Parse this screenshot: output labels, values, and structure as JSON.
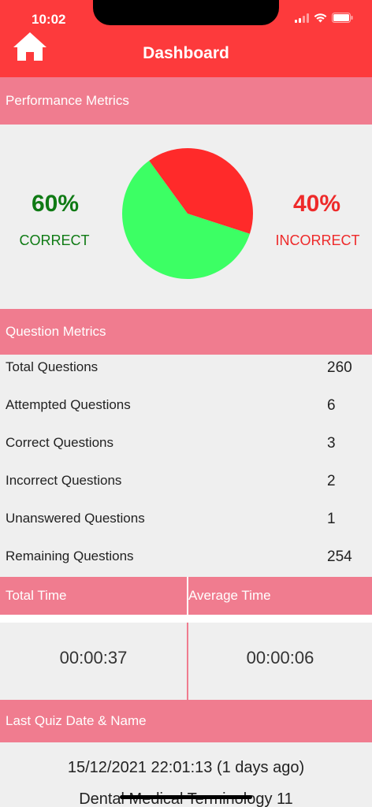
{
  "status_bar": {
    "time": "10:02"
  },
  "header": {
    "title": "Dashboard",
    "home_icon": "home-icon"
  },
  "performance": {
    "section_title": "Performance Metrics",
    "correct_percent": "60%",
    "correct_label": "CORRECT",
    "incorrect_percent": "40%",
    "incorrect_label": "INCORRECT",
    "correct_color": "#3cff64",
    "incorrect_color": "#ff2a2a"
  },
  "chart_data": {
    "type": "pie",
    "categories": [
      "CORRECT",
      "INCORRECT"
    ],
    "values": [
      60,
      40
    ],
    "colors": [
      "#3cff64",
      "#ff2a2a"
    ]
  },
  "questions": {
    "section_title": "Question Metrics",
    "rows": [
      {
        "label": "Total Questions",
        "value": "260"
      },
      {
        "label": "Attempted Questions",
        "value": "6"
      },
      {
        "label": "Correct Questions",
        "value": "3"
      },
      {
        "label": "Incorrect Questions",
        "value": "2"
      },
      {
        "label": "Unanswered Questions",
        "value": "1"
      },
      {
        "label": "Remaining Questions",
        "value": "254"
      }
    ]
  },
  "times": {
    "total_label": "Total Time",
    "total_value": "00:00:37",
    "average_label": "Average Time",
    "average_value": "00:00:06"
  },
  "last_quiz": {
    "section_title": "Last Quiz Date & Name",
    "date": "15/12/2021 22:01:13 (1 days ago)",
    "name": "Dental Medical Terminology 11"
  }
}
